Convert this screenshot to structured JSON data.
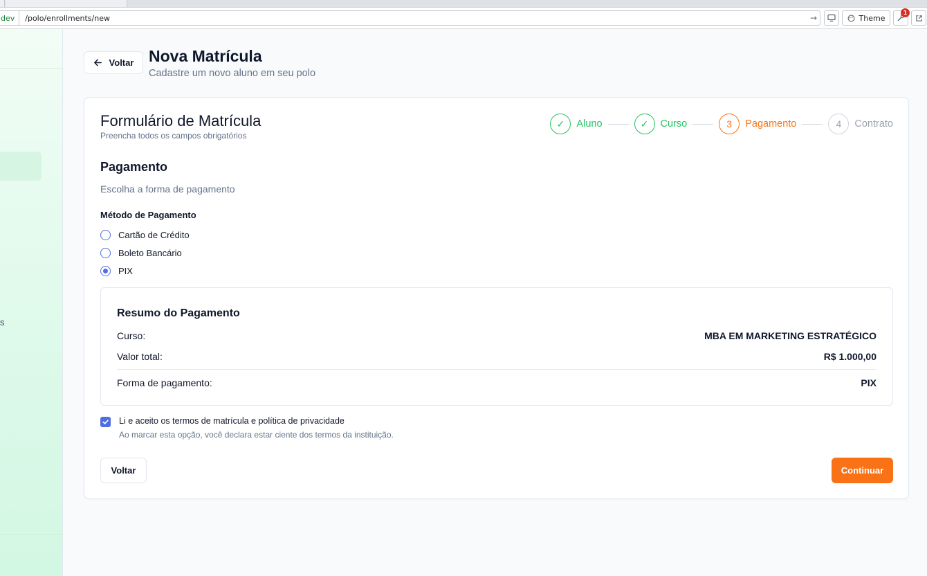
{
  "browser": {
    "url_scheme": "dev",
    "url_path": "/polo/enrollments/new",
    "theme_label": "Theme",
    "notification_count": "1"
  },
  "header": {
    "back_label": "Voltar",
    "title": "Nova Matrícula",
    "subtitle": "Cadastre um novo aluno em seu polo"
  },
  "sidebar": {
    "truncated_label": "s"
  },
  "form": {
    "title": "Formulário de Matrícula",
    "subtitle": "Preencha todos os campos obrigatórios",
    "steps": [
      {
        "marker": "✓",
        "label": "Aluno",
        "state": "done"
      },
      {
        "marker": "✓",
        "label": "Curso",
        "state": "done"
      },
      {
        "marker": "3",
        "label": "Pagamento",
        "state": "current"
      },
      {
        "marker": "4",
        "label": "Contrato",
        "state": "todo"
      }
    ],
    "section_title": "Pagamento",
    "section_desc": "Escolha a forma de pagamento",
    "method_label": "Método de Pagamento",
    "methods": [
      {
        "label": "Cartão de Crédito",
        "selected": false
      },
      {
        "label": "Boleto Bancário",
        "selected": false
      },
      {
        "label": "PIX",
        "selected": true
      }
    ],
    "summary": {
      "title": "Resumo do Pagamento",
      "course_label": "Curso:",
      "course_value": "MBA EM MARKETING ESTRATÉGICO",
      "total_label": "Valor total:",
      "total_value": "R$ 1.000,00",
      "method_label": "Forma de pagamento:",
      "method_value": "PIX"
    },
    "terms": {
      "checked": true,
      "text": "Li e aceito os termos de matrícula e política de privacidade",
      "hint": "Ao marcar esta opção, você declara estar ciente dos termos da instituição."
    },
    "back_button": "Voltar",
    "continue_button": "Continuar"
  },
  "colors": {
    "accent": "#f97316",
    "success": "#22c55e",
    "primary": "#4f6fe0"
  }
}
